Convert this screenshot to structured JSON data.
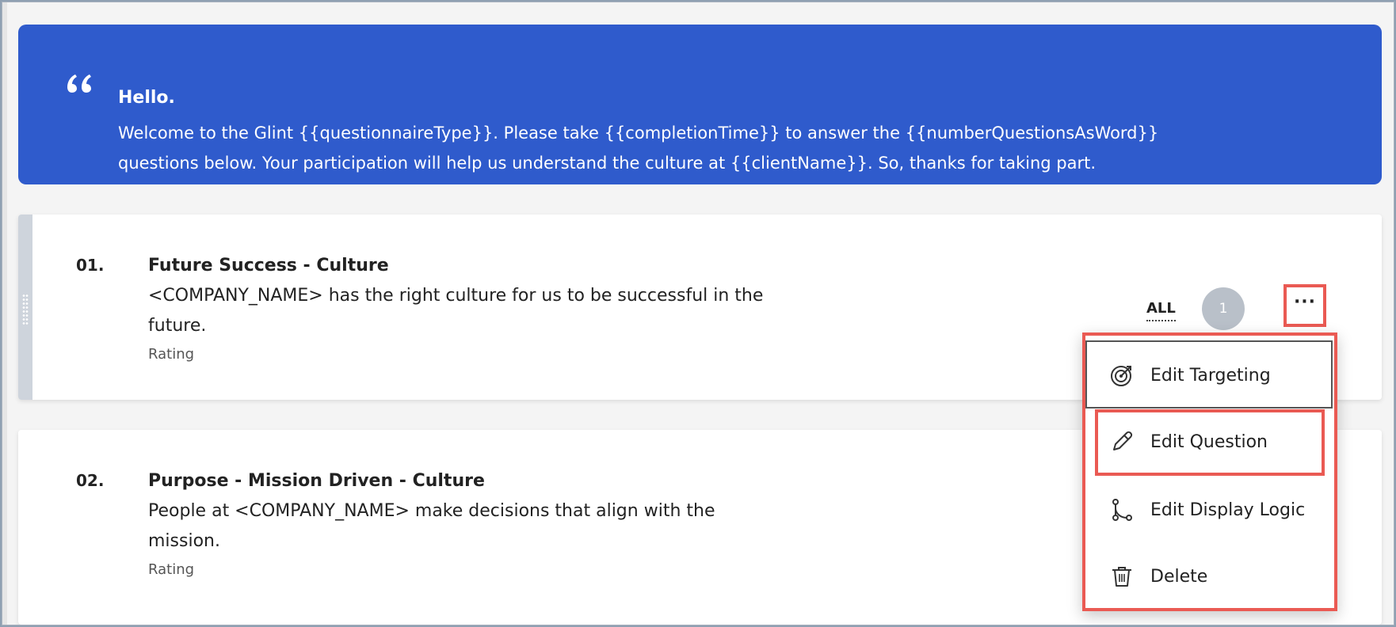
{
  "banner": {
    "greeting": "Hello.",
    "message_line1": "Welcome to the Glint {{questionnaireType}}. Please take {{completionTime}} to answer the {{numberQuestionsAsWord}}",
    "message_line2": "questions below. Your participation will help us understand the culture at {{clientName}}. So, thanks for taking part.",
    "icon": "quote-icon",
    "color": "#2f5bcc"
  },
  "questions": [
    {
      "number": "01.",
      "title": "Future Success - Culture",
      "text_line1": "<COMPANY_NAME> has the right culture for us to be successful in the",
      "text_line2": "future.",
      "type": "Rating",
      "audience": "ALL",
      "count": "1",
      "more_icon": "···"
    },
    {
      "number": "02.",
      "title": "Purpose - Mission Driven - Culture",
      "text_line1": "People at <COMPANY_NAME> make decisions that align with the",
      "text_line2": "mission.",
      "type": "Rating"
    }
  ],
  "menu": {
    "items": [
      {
        "label": "Edit Targeting",
        "icon": "target-icon"
      },
      {
        "label": "Edit Question",
        "icon": "pencil-icon"
      },
      {
        "label": "Edit Display Logic",
        "icon": "logic-icon"
      },
      {
        "label": "Delete",
        "icon": "trash-icon"
      }
    ]
  },
  "colors": {
    "highlight": "#ea5a53",
    "accent": "#2f5bcc"
  }
}
